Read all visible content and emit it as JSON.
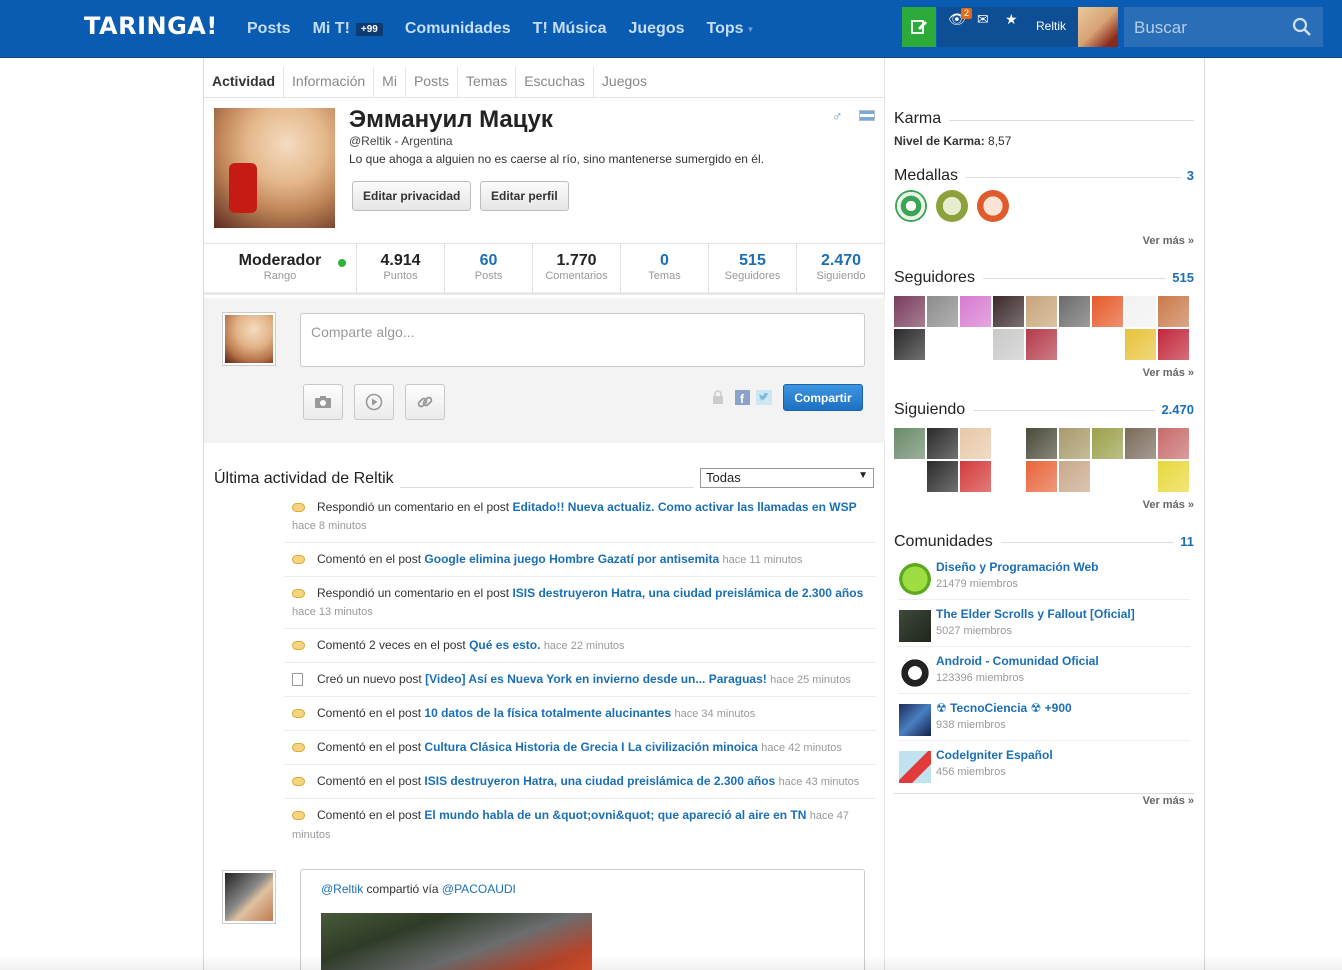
{
  "header": {
    "logo": "TARINGA!",
    "nav": [
      {
        "label": "Posts"
      },
      {
        "label": "Mi T!",
        "badge": "+99"
      },
      {
        "label": "Comunidades"
      },
      {
        "label": "T! Música"
      },
      {
        "label": "Juegos"
      },
      {
        "label": "Tops"
      }
    ],
    "notif_count": "2",
    "username": "Reltik",
    "search_placeholder": "Buscar"
  },
  "tabs": [
    "Actividad",
    "Información",
    "Mi",
    "Posts",
    "Temas",
    "Escuchas",
    "Juegos"
  ],
  "profile": {
    "name": "Эммануил Мацук",
    "handle": "@Reltik - Argentina",
    "quote": "Lo que ahoga a alguien no es caerse al río, sino mantenerse sumergido en él.",
    "edit_privacy": "Editar privacidad",
    "edit_profile": "Editar perfil"
  },
  "stats": {
    "rank": {
      "value": "Moderador",
      "label": "Rango"
    },
    "points": {
      "value": "4.914",
      "label": "Puntos"
    },
    "posts": {
      "value": "60",
      "label": "Posts"
    },
    "comments": {
      "value": "1.770",
      "label": "Comentarios"
    },
    "topics": {
      "value": "0",
      "label": "Temas"
    },
    "followers": {
      "value": "515",
      "label": "Seguidores"
    },
    "following": {
      "value": "2.470",
      "label": "Siguiendo"
    }
  },
  "share": {
    "placeholder": "Comparte algo...",
    "button": "Compartir"
  },
  "activity": {
    "title": "Última actividad de Reltik",
    "filter": "Todas",
    "items": [
      {
        "icon": "comment",
        "pre": "Respondió un comentario en el post ",
        "link": "Editado!! Nueva actualiz. Como activar las llamadas en WSP",
        "time": "hace 8 minutos"
      },
      {
        "icon": "comment",
        "pre": "Comentó en el post ",
        "link": "Google elimina juego Hombre Gazatí por antisemita",
        "time": "hace 11 minutos"
      },
      {
        "icon": "comment",
        "pre": "Respondió un comentario en el post ",
        "link": "ISIS destruyeron Hatra, una ciudad preislámica de 2.300 años",
        "time": "hace 13 minutos"
      },
      {
        "icon": "comment",
        "pre": "Comentó 2 veces en el post ",
        "link": "Qué es esto.",
        "time": "hace 22 minutos"
      },
      {
        "icon": "document",
        "pre": "Creó un nuevo post ",
        "link": "[Video] Así es Nueva York en invierno desde un... Paraguas!",
        "time": "hace 25 minutos"
      },
      {
        "icon": "comment",
        "pre": "Comentó en el post ",
        "link": "10 datos de la física totalmente alucinantes",
        "time": "hace 34 minutos"
      },
      {
        "icon": "comment",
        "pre": "Comentó en el post ",
        "link": "Cultura Clásica Historia de Grecia I La civilización minoica",
        "time": "hace 42 minutos"
      },
      {
        "icon": "comment",
        "pre": "Comentó en el post ",
        "link": "ISIS destruyeron Hatra, una ciudad preislámica de 2.300 años",
        "time": "hace 43 minutos"
      },
      {
        "icon": "comment",
        "pre": "Comentó en el post ",
        "link": "El mundo habla de un &quot;ovni&quot; que apareció al aire en TN",
        "time": "hace 47 minutos"
      }
    ]
  },
  "shared": {
    "user": "@Reltik",
    "via_text": " compartió vía ",
    "via_user": "@PACOAUDI"
  },
  "sidebar": {
    "karma": {
      "title": "Karma",
      "label": "Nivel de Karma:",
      "value": "8,57"
    },
    "medals": {
      "title": "Medallas",
      "count": "3",
      "more": "Ver más »",
      "colors": [
        "#3aa655",
        "#8ca03c",
        "#e05a2a"
      ]
    },
    "followers": {
      "title": "Seguidores",
      "count": "515",
      "more": "Ver más »"
    },
    "following": {
      "title": "Siguiendo",
      "count": "2.470",
      "more": "Ver más »"
    },
    "communities": {
      "title": "Comunidades",
      "count": "11",
      "more": "Ver más »",
      "items": [
        {
          "name": "Diseño y Programación Web",
          "members": "21479 miembros"
        },
        {
          "name": "The Elder Scrolls y Fallout [Oficial]",
          "members": "5027 miembros"
        },
        {
          "name": "Android - Comunidad Oficial",
          "members": "123396 miembros"
        },
        {
          "name": "☢ TecnoCiencia ☢ +900",
          "members": "938 miembros"
        },
        {
          "name": "CodeIgniter Español",
          "members": "456 miembros"
        }
      ]
    }
  }
}
